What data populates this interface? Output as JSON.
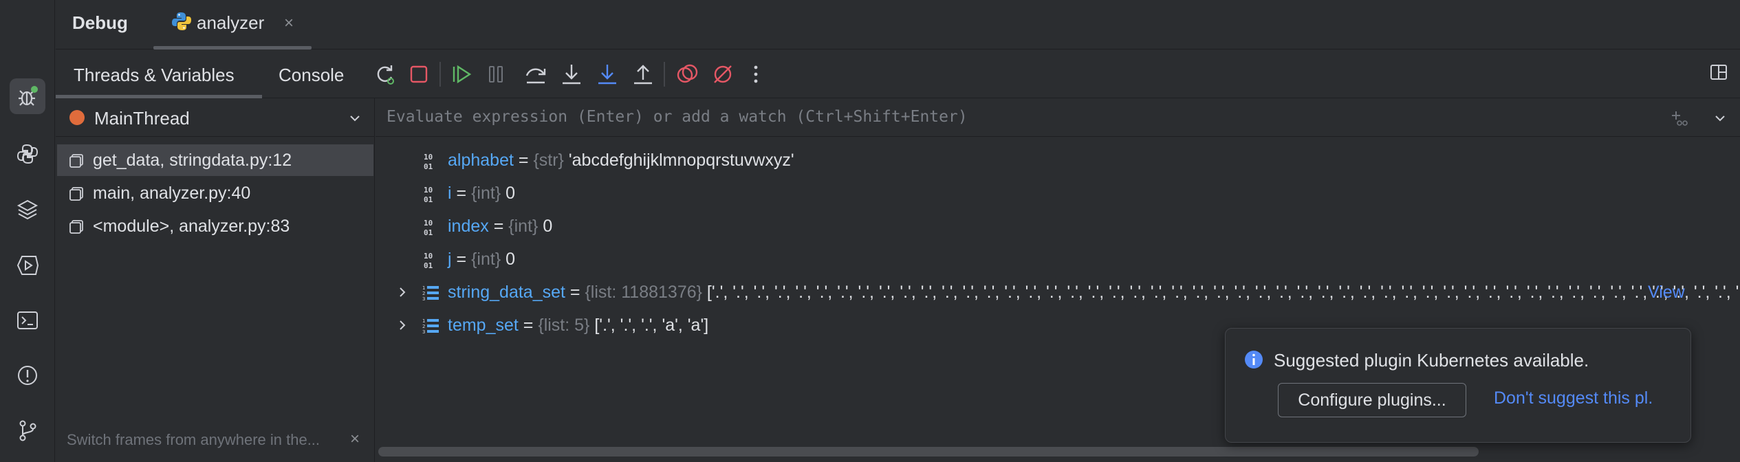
{
  "top": {
    "debug_title": "Debug",
    "run_tab_label": "analyzer",
    "run_tab_close": "×"
  },
  "toolbar": {
    "tabs": [
      {
        "label": "Threads & Variables"
      },
      {
        "label": "Console"
      }
    ],
    "icons": [
      "rerun-icon",
      "stop-icon",
      "resume-icon",
      "pause-icon",
      "step-over-icon",
      "step-into-icon",
      "step-into-my-code-icon",
      "step-out-icon",
      "view-breakpoints-icon",
      "mute-breakpoints-icon",
      "more-icon"
    ]
  },
  "threads": {
    "selected_thread": "MainThread",
    "frames": [
      {
        "label": "get_data, stringdata.py:12"
      },
      {
        "label": "main, analyzer.py:40"
      },
      {
        "label": "<module>, analyzer.py:83"
      }
    ],
    "hint": "Switch frames from anywhere in the...",
    "hint_close": "×"
  },
  "eval": {
    "placeholder": "Evaluate expression (Enter) or add a watch (Ctrl+Shift+Enter)"
  },
  "variables": [
    {
      "name": "alphabet",
      "eq": " = ",
      "type": "{str}",
      "value": " 'abcdefghijklmnopqrstuvwxyz'"
    },
    {
      "name": "i",
      "eq": " = ",
      "type": "{int}",
      "value": " 0"
    },
    {
      "name": "index",
      "eq": " = ",
      "type": "{int}",
      "value": " 0"
    },
    {
      "name": "j",
      "eq": " = ",
      "type": "{int}",
      "value": " 0"
    },
    {
      "name": "string_data_set",
      "eq": " = ",
      "type": "{list: 11881376}",
      "value": " ['.', '.', '.', '.', '.', '.', '.', '.', '.', '.', '.', '.', '.', '.', '.', '.', '.', '.', '.', '.', '.', '.', '.', '.', '.', '.', '.', '.', '.', '.', '.', '.', '.', '.', '.', '.', '.', '.', '.', '.', '.', '.', '.', '.', '.', '.', '.', '.', '.', '.', '.', '.', '.', '.', '.', '.', '.',...",
      "view": "View"
    },
    {
      "name": "temp_set",
      "eq": " = ",
      "type": "{list: 5}",
      "value": " ['.', '.', '.', 'a', 'a']"
    }
  ],
  "notification": {
    "message": "Suggested plugin Kubernetes available.",
    "configure_label": "Configure plugins...",
    "dont_suggest_label": "Don't suggest this pl."
  },
  "colors": {
    "background": "#2b2d30",
    "var_name": "#56a8f5",
    "link": "#548af7",
    "thread_dot": "#e06c3c"
  }
}
